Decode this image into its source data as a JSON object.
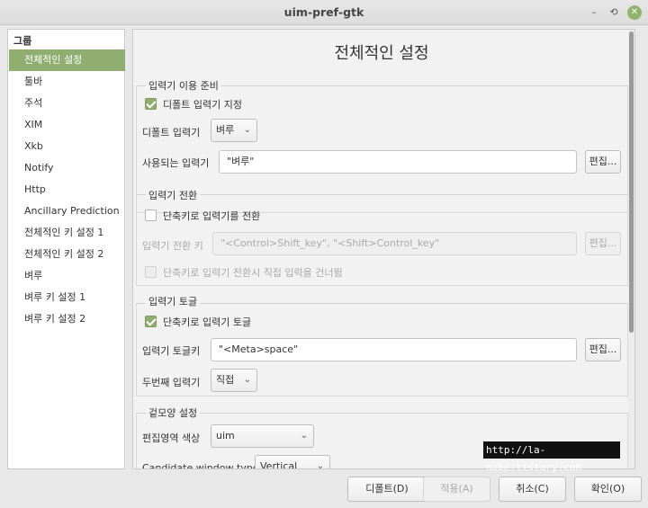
{
  "window": {
    "title": "uim-pref-gtk",
    "min_glyph": "–",
    "restore_glyph": "⟲",
    "close_glyph": "✕"
  },
  "sidebar": {
    "header": "그룹",
    "items": [
      {
        "label": "전체적인 설정",
        "selected": true
      },
      {
        "label": "툴바"
      },
      {
        "label": "주석"
      },
      {
        "label": "XIM"
      },
      {
        "label": "Xkb"
      },
      {
        "label": "Notify"
      },
      {
        "label": "Http"
      },
      {
        "label": "Ancillary Prediction"
      },
      {
        "label": "전체적인 키 설정 1"
      },
      {
        "label": "전체적인 키 설정 2"
      },
      {
        "label": "벼루"
      },
      {
        "label": "벼루 키 설정 1"
      },
      {
        "label": "벼루 키 설정 2"
      }
    ]
  },
  "panel": {
    "title": "전체적인 설정",
    "im_prep": {
      "label": "입력기 이용 준비",
      "default_check": {
        "label": "디폴트 입력기 지정",
        "checked": true
      },
      "default_im": {
        "label": "디폴트 입력기",
        "value": "벼루"
      },
      "used_im": {
        "label": "사용되는 입력기",
        "value": "\"벼루\"",
        "edit": "편집..."
      }
    },
    "im_switch": {
      "label": "입력기 전환",
      "shortcut_check": {
        "label": "단축키로 입력기를 전환",
        "checked": false
      },
      "switch_key": {
        "label": "입력기 전환 키",
        "value": "\"<Control>Shift_key\", \"<Shift>Control_key\"",
        "edit": "편집..."
      },
      "skip_check": {
        "label": "단축키로 입력기 전환시 직접 입력을 건너뜀",
        "checked": false
      }
    },
    "im_toggle": {
      "label": "입력기 토글",
      "shortcut_check": {
        "label": "단축키로 입력기 토글",
        "checked": true
      },
      "toggle_key": {
        "label": "입력기 토글키",
        "value": "\"<Meta>space\"",
        "edit": "편집..."
      },
      "second_im": {
        "label": "두번째 입력기",
        "value": "직접"
      }
    },
    "appearance": {
      "label": "겉모양 설정",
      "preedit_color": {
        "label": "편집영역 색상",
        "value": "uim"
      },
      "candidate_type": {
        "label": "Candidate window type",
        "value": "Vertical"
      }
    }
  },
  "overlay_text": "http://la-nube.tistory.com",
  "footer": {
    "default": "디폴트(D)",
    "apply": "적용(A)",
    "cancel": "취소(C)",
    "ok": "확인(O)"
  },
  "colors": {
    "accent": "#8fae70"
  }
}
